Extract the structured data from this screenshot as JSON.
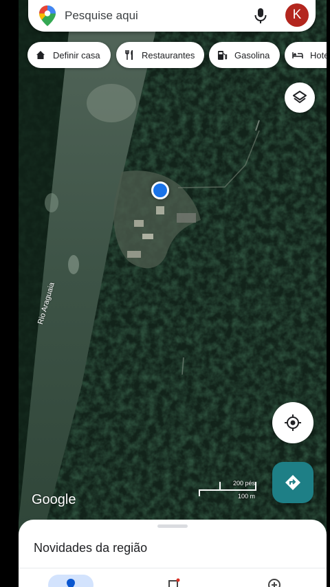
{
  "search": {
    "placeholder": "Pesquise aqui",
    "avatar_initial": "K"
  },
  "chips": [
    {
      "label": "Definir casa",
      "icon": "home-icon"
    },
    {
      "label": "Restaurantes",
      "icon": "restaurant-icon"
    },
    {
      "label": "Gasolina",
      "icon": "gas-station-icon"
    },
    {
      "label": "Hoteis",
      "icon": "hotel-icon"
    }
  ],
  "map": {
    "river_label": "Rio Araguaia",
    "google_label": "Google",
    "scale_top": "200 pés",
    "scale_bottom": "100 m"
  },
  "sheet": {
    "title": "Novidades da região"
  },
  "colors": {
    "accent": "#1e7f86",
    "avatar": "#b3261e",
    "location": "#1a73e8"
  }
}
